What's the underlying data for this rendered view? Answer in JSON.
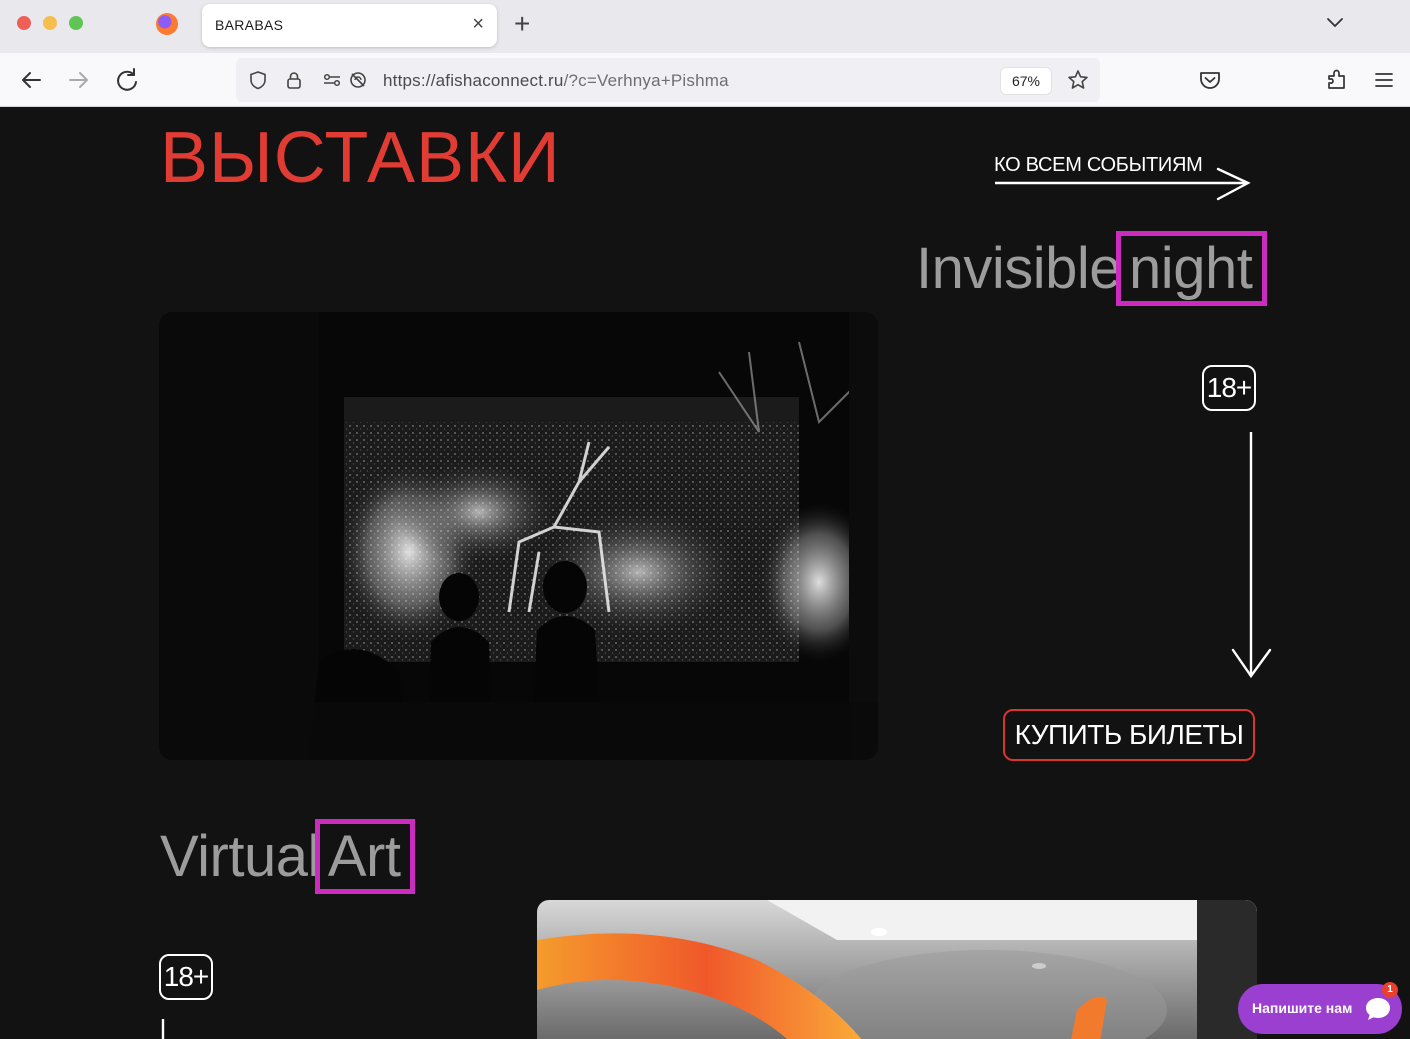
{
  "browser": {
    "tab_title": "BARABAS",
    "close_glyph": "×",
    "new_tab_glyph": "+",
    "url_host": "https://afishaconnect.ru",
    "url_rest": "/?c=Verhnya+Pishma",
    "zoom": "67%",
    "icons": [
      "firefox-logo-icon",
      "back-icon",
      "forward-icon",
      "reload-icon",
      "shield-icon",
      "lock-icon",
      "permissions-icon",
      "tracking-blocked-icon",
      "bookmark-star-icon",
      "pocket-icon",
      "extensions-icon",
      "menu-icon",
      "tab-list-chevron-icon"
    ]
  },
  "page": {
    "section_title": "ВЫСТАВКИ",
    "all_events_link": "КО ВСЕМ СОБЫТИЯМ",
    "events": [
      {
        "title_part1": "Invisible",
        "title_part2": "night",
        "age": "18+",
        "buy_label": "КУПИТЬ БИЛЕТЫ"
      },
      {
        "title_part1": "Virtual",
        "title_part2": "Art",
        "age": "18+"
      }
    ],
    "chat_widget": {
      "label": "Напишите нам",
      "badge": "1"
    },
    "colors": {
      "accent_red": "#e03c33",
      "highlight_magenta": "#cc2bbf",
      "chat_purple": "#9b3fd1",
      "background": "#121212"
    }
  }
}
